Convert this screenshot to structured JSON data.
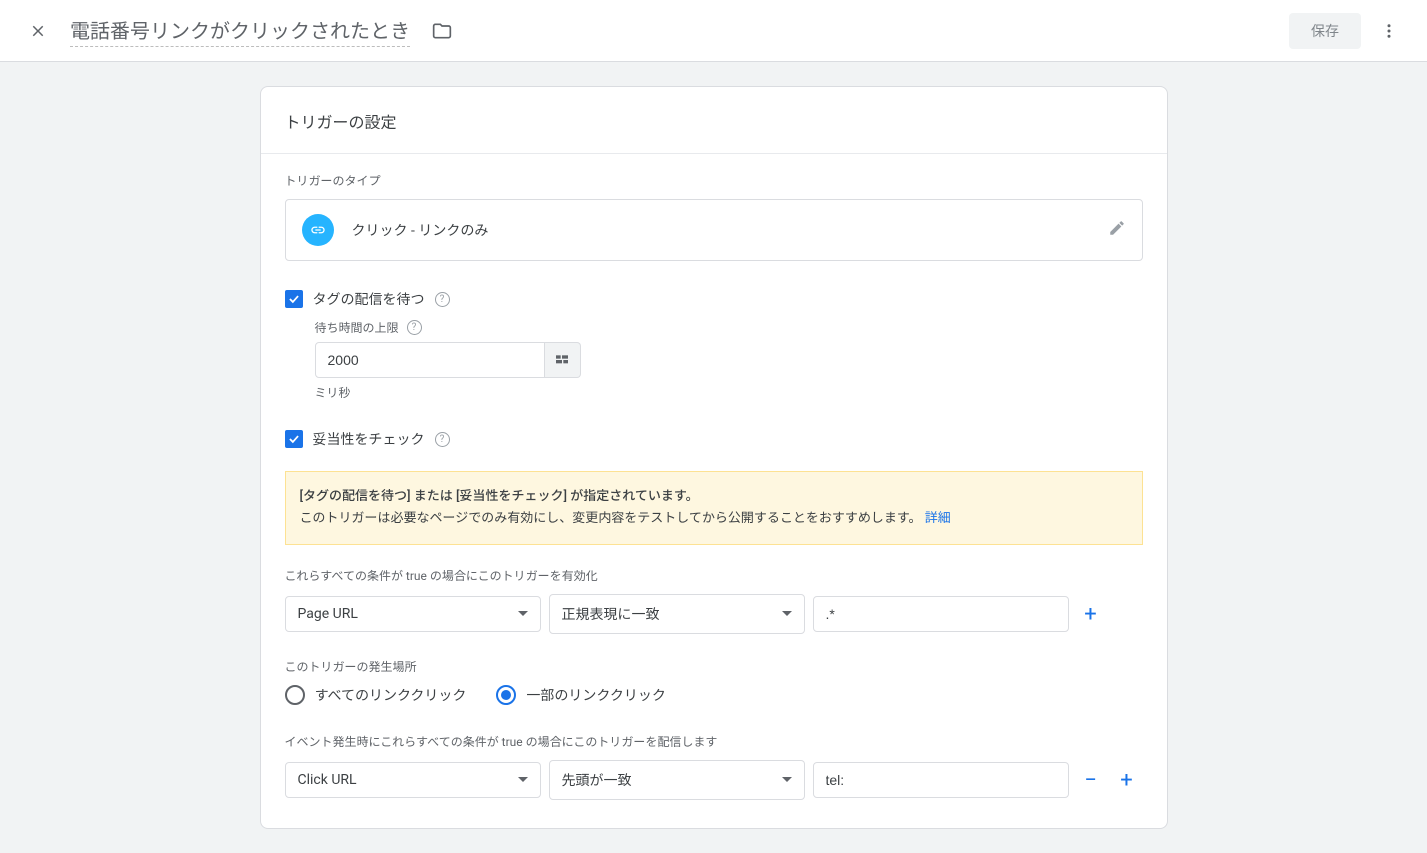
{
  "header": {
    "title": "電話番号リンクがクリックされたとき",
    "save_label": "保存"
  },
  "card": {
    "title": "トリガーの設定",
    "trigger_type_section_label": "トリガーのタイプ",
    "trigger_type_value": "クリック - リンクのみ",
    "wait_checkbox_label": "タグの配信を待つ",
    "wait_limit_label": "待ち時間の上限",
    "wait_limit_value": "2000",
    "wait_limit_unit": "ミリ秒",
    "validate_checkbox_label": "妥当性をチェック",
    "warning_bold": "[タグの配信を待つ] または [妥当性をチェック] が指定されています。",
    "warning_text": "このトリガーは必要なページでのみ有効にし、変更内容をテストしてから公開することをおすすめします。",
    "warning_link": "詳細",
    "enable_condition_label": "これらすべての条件が true の場合にこのトリガーを有効化",
    "enable_condition": {
      "variable": "Page URL",
      "operator": "正規表現に一致",
      "value": ".*"
    },
    "fire_location_label": "このトリガーの発生場所",
    "fire_all_label": "すべてのリンククリック",
    "fire_some_label": "一部のリンククリック",
    "fire_condition_label": "イベント発生時にこれらすべての条件が true の場合にこのトリガーを配信します",
    "fire_condition": {
      "variable": "Click URL",
      "operator": "先頭が一致",
      "value": "tel:"
    }
  }
}
